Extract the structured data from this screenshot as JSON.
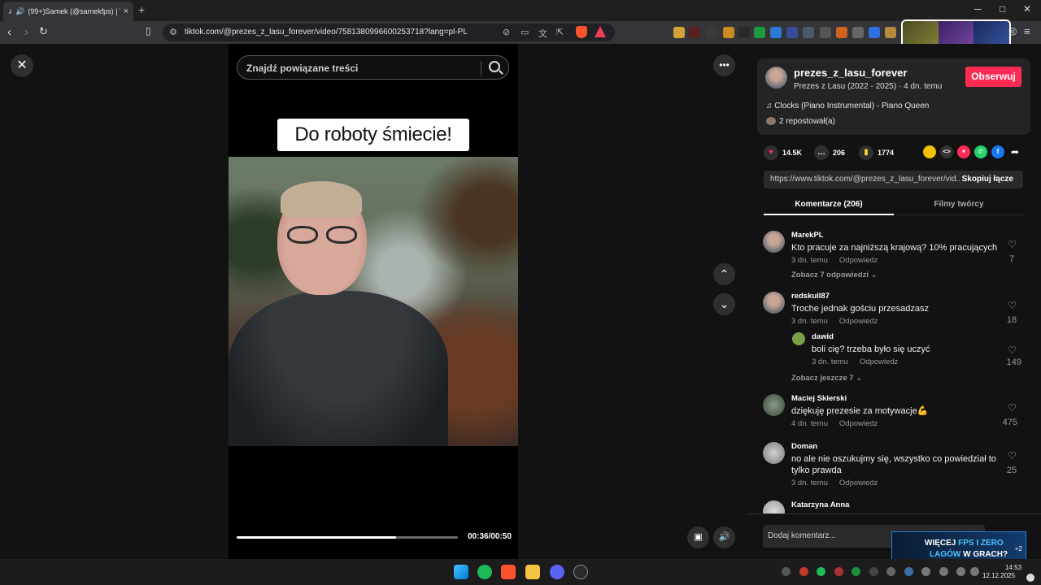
{
  "browser": {
    "tab_title": "(99+)Samek (@samekfps) | Ti",
    "tab_close": "×",
    "new_tab": "+",
    "url": "tiktok.com/@prezes_z_lasu_forever/video/7581380996600253718?lang=pl-PL",
    "win_min": "─",
    "win_max": "□",
    "win_close": "✕"
  },
  "video": {
    "search_placeholder": "Znajdź powiązane treści",
    "caption": "Do roboty śmiecie!",
    "time": "00:36/00:50",
    "progress_fraction": 0.72
  },
  "author": {
    "username": "prezes_z_lasu_forever",
    "nickname_line": "Prezes z Lasu (2022 - 2025) · 4 dn. temu",
    "follow_label": "Obserwuj",
    "music": "Clocks (Piano Instrumental) - Piano Queen",
    "reposts": "2 repostował(a)"
  },
  "stats": {
    "likes": "14.5K",
    "comments": "206",
    "saves": "1774"
  },
  "link": {
    "text": "https://www.tiktok.com/@prezes_z_lasu_forever/vid...",
    "copy_label": "Skopiuj łącze"
  },
  "tabs": {
    "comments": "Komentarze (206)",
    "creator_videos": "Filmy twórcy"
  },
  "comments": [
    {
      "user": "MarekPL",
      "text": "Kto pracuje za najniższą krajową? 10% pracujących",
      "time": "3 dn. temu",
      "reply": "Odpowiedz",
      "likes": "7",
      "more": "Zobacz 7 odpowiedzi"
    },
    {
      "user": "redskull87",
      "text": "Troche jednak gościu przesadzasz",
      "time": "3 dn. temu",
      "reply": "Odpowiedz",
      "likes": "18"
    },
    {
      "user": "dawid",
      "text": "boli cię? trzeba było się uczyć",
      "time": "3 dn. temu",
      "reply": "Odpowiedz",
      "likes": "149",
      "more": "Zobacz jeszcze 7"
    },
    {
      "user": "Maciej Skierski",
      "text": "dziękuję prezesie za motywacje💪",
      "time": "4 dn. temu",
      "reply": "Odpowiedz",
      "likes": "475"
    },
    {
      "user": "Doman",
      "text": "no ale nie oszukujmy się, wszystko co powiedział to tylko prawda",
      "time": "3 dn. temu",
      "reply": "Odpowiedz",
      "likes": "25"
    },
    {
      "user": "Katarzyna Anna"
    }
  ],
  "add_comment_placeholder": "Dodaj komentarz...",
  "ad": {
    "line1a": "WIĘCEJ ",
    "line1b": "FPS I ZERO",
    "line2a": "LAGÓW",
    "line2b": " W GRACH?",
    "badge": "+2"
  },
  "taskbar": {
    "time": "14:53",
    "date": "12.12.2025"
  },
  "colors": {
    "accent": "#fe2c55",
    "panel_bg": "#121212"
  }
}
